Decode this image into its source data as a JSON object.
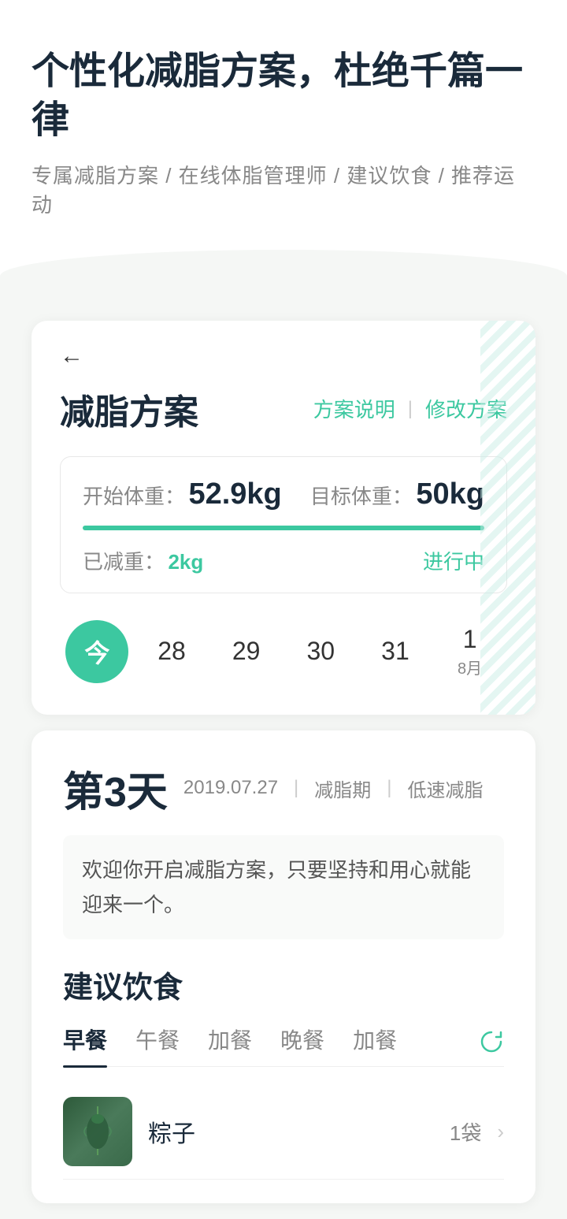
{
  "header": {
    "title": "个性化减脂方案，杜绝千篇一律",
    "subtitle": "专属减脂方案 / 在线体脂管理师 / 建议饮食 / 推荐运动"
  },
  "plan_card": {
    "back_label": "←",
    "title": "减脂方案",
    "action_explain": "方案说明",
    "action_divider": "|",
    "action_modify": "修改方案",
    "start_weight_label": "开始体重：",
    "start_weight_value": "52.9kg",
    "target_weight_label": "目标体重：",
    "target_weight_value": "50kg",
    "lost_label": "已减重：",
    "lost_value": "2kg",
    "status": "进行中"
  },
  "calendar": {
    "today_label": "今",
    "days": [
      "28",
      "29",
      "30",
      "31"
    ],
    "next_day": "1",
    "next_month": "8月"
  },
  "day_info": {
    "day_number": "第3天",
    "date": "2019.07.27",
    "sep1": "|",
    "phase": "减脂期",
    "sep2": "|",
    "speed": "低速减脂",
    "welcome": "欢迎你开启减脂方案，只要坚持和用心就能迎来一个。"
  },
  "diet": {
    "title": "建议饮食",
    "tabs": [
      {
        "label": "早餐",
        "active": true
      },
      {
        "label": "午餐",
        "active": false
      },
      {
        "label": "加餐",
        "active": false
      },
      {
        "label": "晚餐",
        "active": false
      },
      {
        "label": "加餐",
        "active": false
      }
    ],
    "refresh_icon": "↻",
    "food_items": [
      {
        "name": "粽子",
        "amount": "1袋",
        "has_arrow": true
      }
    ]
  }
}
